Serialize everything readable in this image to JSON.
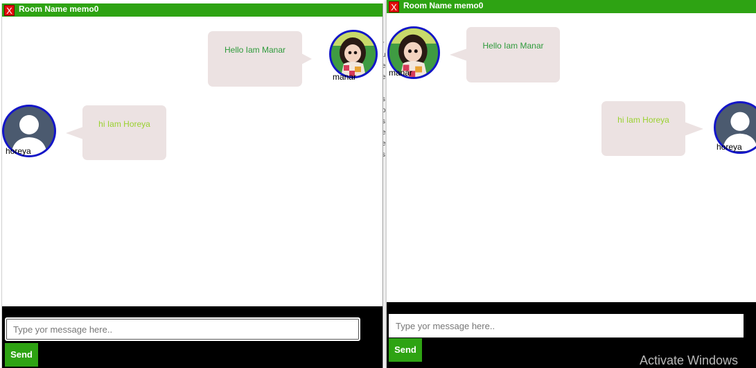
{
  "left_window": {
    "close_label": "X",
    "title": "Room Name memo0",
    "messages": [
      {
        "text": "Hello Iam Manar",
        "user": "manar"
      },
      {
        "text": "hi Iam Horeya",
        "user": "horeya"
      }
    ],
    "input": {
      "placeholder": "Type yor message here..",
      "value": ""
    },
    "send_label": "Send"
  },
  "right_window": {
    "close_label": "X",
    "title": "Room Name memo0",
    "messages": [
      {
        "text": "Hello Iam Manar",
        "user": "manar"
      },
      {
        "text": "hi Iam Horeya",
        "user": "horeya"
      }
    ],
    "input": {
      "placeholder": "Type yor message here..",
      "value": ""
    },
    "send_label": "Send"
  },
  "background_fragments": [
    "r",
    "u",
    "e",
    "e",
    "s",
    "o",
    "s",
    "e",
    "e",
    "s"
  ],
  "watermark": "Activate Windows",
  "colors": {
    "title_bar": "#2ea313",
    "close_button": "#e20c0c",
    "avatar_border": "#1416c8",
    "bubble_bg": "#ece2e2",
    "manar_text": "#2e9a3b",
    "horeya_text": "#99d12f",
    "footer_bg": "#000000"
  }
}
